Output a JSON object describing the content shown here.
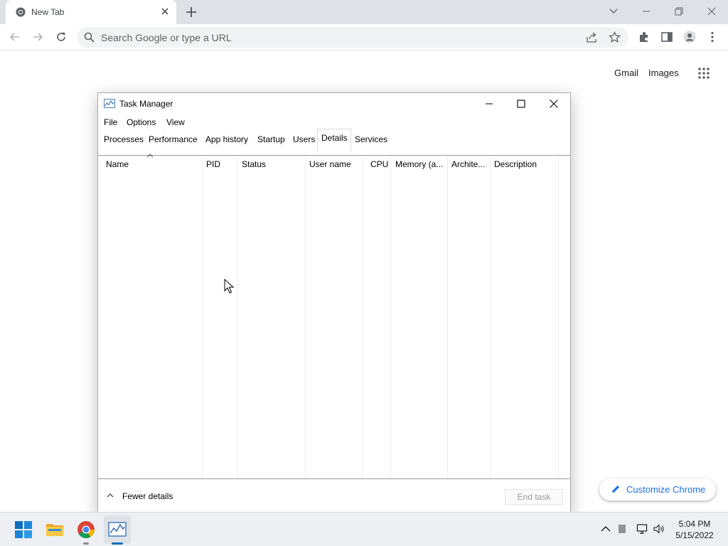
{
  "browser": {
    "tab_title": "New Tab",
    "omnibox_placeholder": "Search Google or type a URL"
  },
  "ntp": {
    "gmail": "Gmail",
    "images": "Images",
    "customize_chrome": "Customize Chrome"
  },
  "task_manager": {
    "title": "Task Manager",
    "menu": [
      "File",
      "Options",
      "View"
    ],
    "tabs": [
      "Processes",
      "Performance",
      "App history",
      "Startup",
      "Users",
      "Details",
      "Services"
    ],
    "active_tab": "Details",
    "columns": [
      "Name",
      "PID",
      "Status",
      "User name",
      "CPU",
      "Memory (a...",
      "Archite...",
      "Description"
    ],
    "sort_column": "Name",
    "fewer_details": "Fewer details",
    "end_task": "End task"
  },
  "taskbar": {
    "apps": [
      "start-menu",
      "file-explorer",
      "chrome",
      "task-manager"
    ],
    "active_app": "task-manager",
    "time": "5:04 PM",
    "date": "5/15/2022"
  },
  "colors": {
    "accent_blue": "#1a73e8",
    "tabstrip": "#dee1e6",
    "taskbar": "#eeeff3"
  }
}
